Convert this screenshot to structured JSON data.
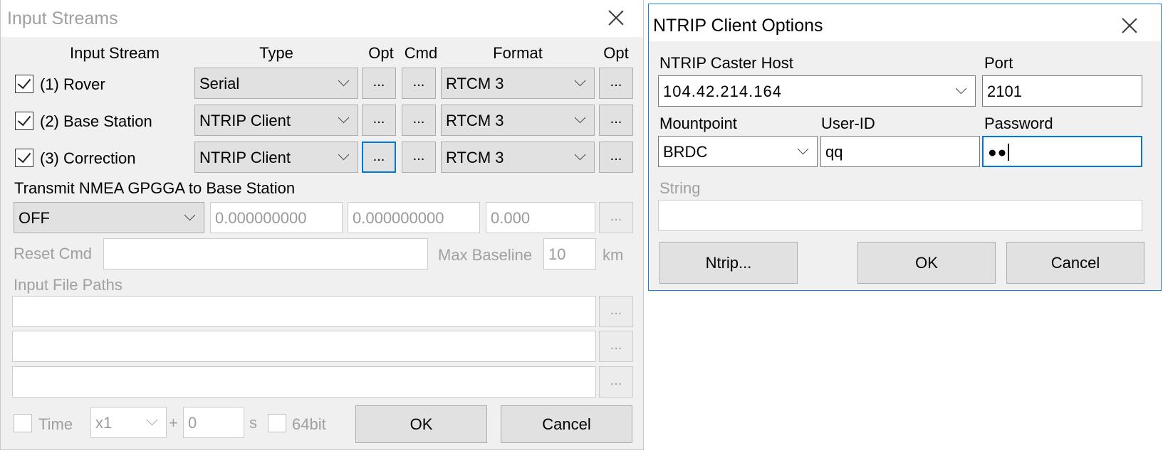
{
  "input_streams": {
    "title": "Input Streams",
    "headers": {
      "input_stream": "Input Stream",
      "type": "Type",
      "opt": "Opt",
      "cmd": "Cmd",
      "format": "Format",
      "opt2": "Opt"
    },
    "rows": [
      {
        "checked": true,
        "label": "(1) Rover",
        "type": "Serial",
        "opt": "...",
        "cmd": "...",
        "format": "RTCM 3",
        "opt2": "..."
      },
      {
        "checked": true,
        "label": "(2) Base Station",
        "type": "NTRIP Client",
        "opt": "...",
        "cmd": "...",
        "format": "RTCM 3",
        "opt2": "..."
      },
      {
        "checked": true,
        "label": "(3) Correction",
        "type": "NTRIP Client",
        "opt": "...",
        "cmd": "...",
        "format": "RTCM 3",
        "opt2": "..."
      }
    ],
    "nmea": {
      "label": "Transmit NMEA GPGGA to Base Station",
      "mode": "OFF",
      "lat": "0.000000000",
      "lon": "0.000000000",
      "height": "0.000",
      "button": "..."
    },
    "reset_cmd_label": "Reset Cmd",
    "reset_cmd_value": "",
    "max_baseline_label": "Max Baseline",
    "max_baseline_value": "10",
    "max_baseline_unit": "km",
    "file_paths_label": "Input File Paths",
    "file_paths": [
      {
        "value": "",
        "button": "..."
      },
      {
        "value": "",
        "button": "..."
      },
      {
        "value": "",
        "button": "..."
      }
    ],
    "time_label": "Time",
    "speed": "x1",
    "plus": "+",
    "offset": "0",
    "offset_unit": "s",
    "bit64_label": "64bit",
    "ok": "OK",
    "cancel": "Cancel"
  },
  "ntrip_options": {
    "title": "NTRIP Client Options",
    "caster_host_label": "NTRIP Caster Host",
    "caster_host": "104.42.214.164",
    "port_label": "Port",
    "port": "2101",
    "mountpoint_label": "Mountpoint",
    "mountpoint": "BRDC",
    "user_id_label": "User-ID",
    "user_id": "qq",
    "password_label": "Password",
    "password_mask": "●●",
    "string_label": "String",
    "string_value": "",
    "ntrip_button": "Ntrip...",
    "ok": "OK",
    "cancel": "Cancel"
  },
  "colors": {
    "focus_accent": "#0078d7",
    "dialog_bg": "#f0f0f0",
    "button_bg": "#e1e1e1"
  }
}
